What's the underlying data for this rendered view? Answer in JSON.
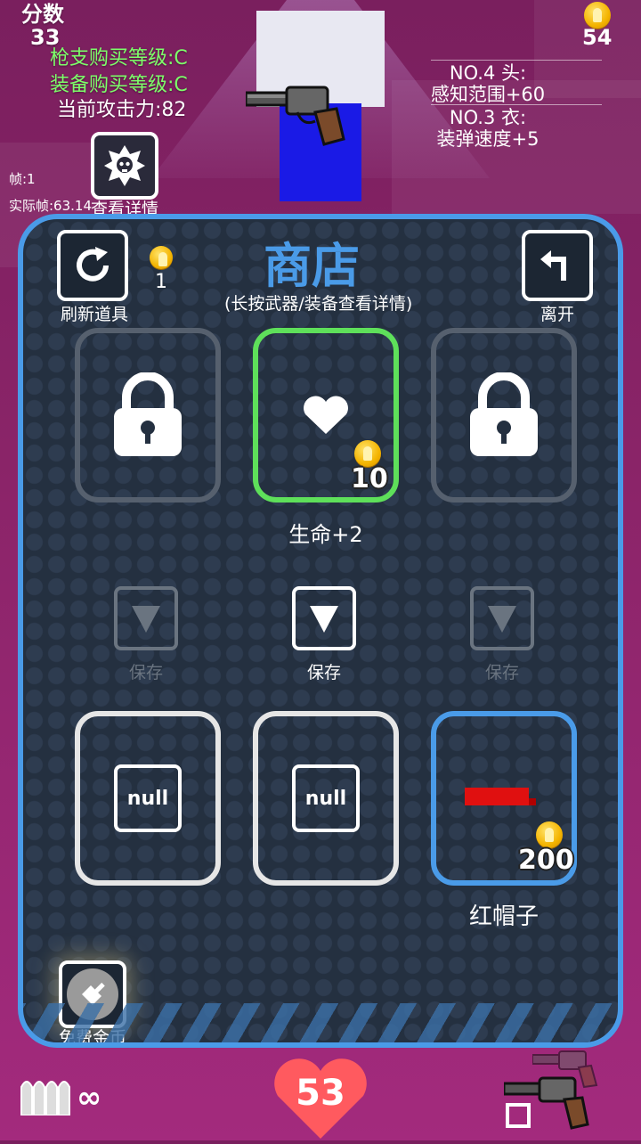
{
  "hud": {
    "score_label": "分数",
    "score_value": "33",
    "gun_level": "枪支购买等级:C",
    "gear_level": "装备购买等级:C",
    "attack": "当前攻击力:82",
    "frame": "帧:1",
    "actual_frame": "实际帧:63.14",
    "view_details": "查看详情",
    "coins": "54",
    "equip1_title": "NO.4 头:",
    "equip1_effect": "感知范围+60",
    "equip2_title": "NO.3 衣:",
    "equip2_effect": "装弹速度+5"
  },
  "shop": {
    "title": "商店",
    "subtitle": "(长按武器/装备查看详情)",
    "refresh_label": "刷新道具",
    "refresh_cost": "1",
    "leave_label": "离开",
    "item_price": "10",
    "item_name": "生命+2",
    "save_labels": [
      "保存",
      "保存",
      "保存"
    ],
    "null_text": "null",
    "hat_price": "200",
    "hat_name": "红帽子",
    "free_coins_label": "免费金币"
  },
  "footer": {
    "ammo": "∞",
    "health": "53"
  },
  "colors": {
    "panel_border": "#4a9be8",
    "selected_slot": "#5ee05a",
    "accent_blue": "#4a9be8",
    "health_red": "#ff5a5f"
  }
}
